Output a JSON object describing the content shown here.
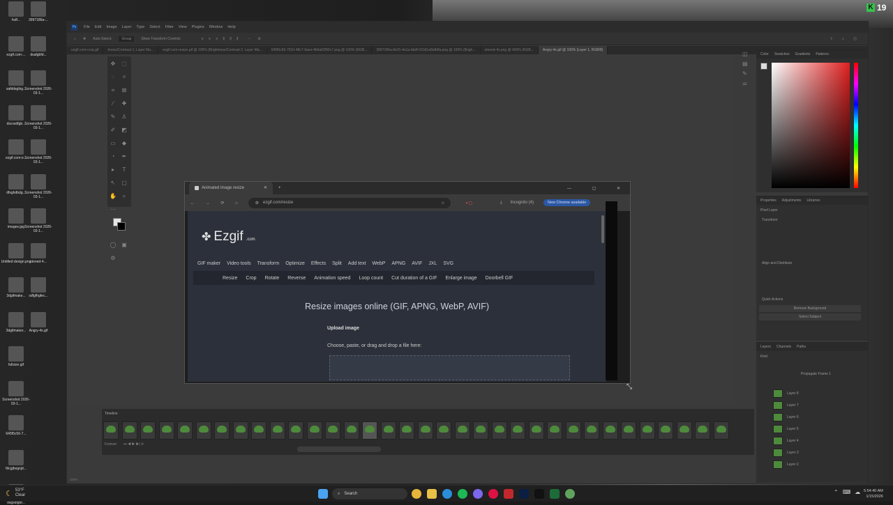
{
  "desktop": {
    "icons_col1": [
      "fsdf...",
      "ezgif.com-...",
      "safddsgfsg...",
      "dscvsdfgb...",
      "ezgif.com-e...",
      "dfsghdbdg...",
      "images.jpg",
      "Untitled design.png",
      "3dgifmake...",
      "3dgifmaker...",
      "fullsize.gif",
      "Screenshot 2026-03-1...",
      "645f5c56-7...",
      "fdcgjhegnjd...",
      "dsgsdfgbf..."
    ],
    "icons_col2": [
      "3997186a-...",
      "dsafgbfd...",
      "Screenshot 2026-03-1...",
      "Screenshot 2026-03-1...",
      "Screenshot 2026-03-1...",
      "Screenshot 2026-03-1...",
      "Screenshot 2026-03-1...",
      "stoned-4...",
      "sdfgfhgfec...",
      "Angry-4x.gif"
    ],
    "badge": "19"
  },
  "photoshop": {
    "menu": [
      "File",
      "Edit",
      "Image",
      "Layer",
      "Type",
      "Select",
      "Filter",
      "View",
      "Plugins",
      "Window",
      "Help"
    ],
    "options": [
      "Auto-Select:",
      "Group",
      "Show Transform Controls"
    ],
    "tabs": [
      "ezgif.com-crop.gif",
      "hness/Contrast 1, Layer Ma...",
      "ezgif.com-resize.gif @ 100% (Brightness/Contrast 2, Layer Ma...",
      "645f5c56-7910-48c7-9aee-4b6a02f92c7.png @ 100% (RGB...",
      "3997186a-8e01-4e1a-bbdf-010d1a8e8dfa.png @ 100% (Brigh...",
      "stoned-4x.png @ 400% (RGB...",
      "Angry-4x.gif @ 100% (Layer 1, RGB/8)"
    ],
    "right_panel": {
      "color_tabs": [
        "Color",
        "Swatches",
        "Gradients",
        "Patterns"
      ],
      "props_tabs": [
        "Properties",
        "Adjustments",
        "Libraries"
      ],
      "pixel_layer": "Pixel Layer",
      "transform": "Transform",
      "align": "Align and Distribute",
      "quick_actions": "Quick Actions",
      "remove_bg": "Remove Background",
      "select_subject": "Select Subject",
      "layers_tabs": [
        "Layers",
        "Channels",
        "Paths"
      ],
      "kind": "Kind",
      "propagate": "Propagate Frame 1",
      "layers": [
        "Layer 8",
        "Layer 7",
        "Layer 6",
        "Layer 5",
        "Layer 4",
        "Layer 3",
        "Layer 2"
      ]
    },
    "timeline_label": "Timeline",
    "timeline_controls": "Forever",
    "status_zoom": "100%"
  },
  "browser": {
    "tab_title": "Animated image resize",
    "url": "ezgif.com/resize",
    "incognito": "Incognito (4)",
    "new_chrome": "New Chrome available",
    "site": {
      "logo": "Ezgif",
      "logo_suffix": ".com",
      "menu": [
        "GIF maker",
        "Video tools",
        "Transform",
        "Optimize",
        "Effects",
        "Split",
        "Add text",
        "WebP",
        "APNG",
        "AVIF",
        "JXL",
        "SVG"
      ],
      "submenu": [
        "Resize",
        "Crop",
        "Rotate",
        "Reverse",
        "Animation speed",
        "Loop count",
        "Cut duration of a GIF",
        "Enlarge image",
        "Doorbell GIF"
      ],
      "heading": "Resize images online (GIF, APNG, WebP, AVIF)",
      "upload_title": "Upload image",
      "upload_hint": "Choose, paste, or drag and drop a file here:"
    }
  },
  "taskbar": {
    "weather_temp": "53°F",
    "weather_desc": "Clear",
    "search": "Search",
    "time": "5:54:40 AM",
    "date": "1/15/2026"
  }
}
